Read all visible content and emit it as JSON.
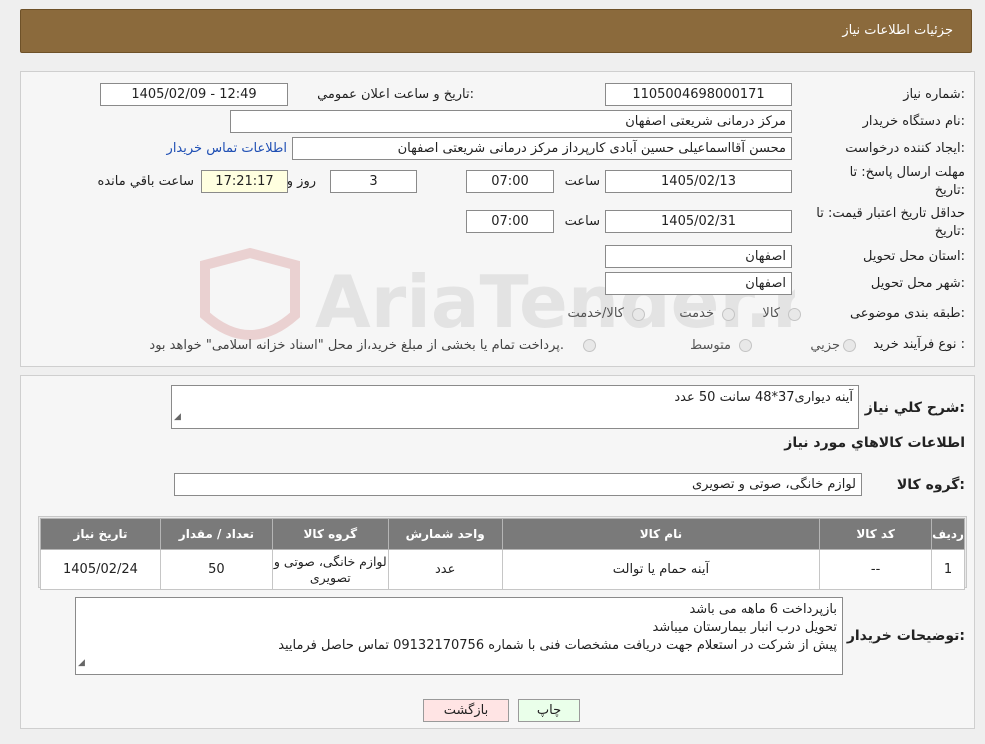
{
  "header": {
    "title": "جزئیات اطلاعات نیاز"
  },
  "watermark": {
    "text": "AriaTender.neT"
  },
  "form": {
    "need_number": {
      "label": "شماره نیاز:",
      "value": "1105004698000171"
    },
    "announce_datetime": {
      "label": "تاریخ و ساعت اعلان عمومي:",
      "value": "1405/02/09 - 12:49"
    },
    "buyer_org": {
      "label": "نام دستگاه خريدار:",
      "value": "مرکز درمانی شریعتی اصفهان"
    },
    "requester": {
      "label": "ايجاد کننده درخواست:",
      "value": "محسن آقااسماعیلی حسین آبادی کارپرداز مرکز درمانی شریعتی اصفهان",
      "contact_link": "اطلاعات تماس خريدار"
    },
    "reply_deadline": {
      "label_line1": "مهلت ارسال پاسخ: تا",
      "label_line2": "تاريخ:",
      "date": "1405/02/13",
      "time_label": "ساعت",
      "time": "07:00",
      "days": "3",
      "days_label": "روز و",
      "remaining": "17:21:17",
      "remaining_label": "ساعت باقي مانده"
    },
    "price_validity": {
      "label_line1": "حداقل تاريخ اعتبار قيمت: تا",
      "label_line2": "تاريخ:",
      "date": "1405/02/31",
      "time_label": "ساعت",
      "time": "07:00"
    },
    "province": {
      "label": "استان محل تحويل:",
      "value": "اصفهان"
    },
    "city": {
      "label": "شهر محل تحويل:",
      "value": "اصفهان"
    },
    "category": {
      "label": "طبقه بندی موضوعی:",
      "options": [
        "کالا",
        "خدمت",
        "کالا/خدمت"
      ]
    },
    "purchase_type": {
      "label": "نوع فرآیند خرید :",
      "options": [
        "جزيي",
        "متوسط"
      ],
      "note": "پرداخت تمام یا بخشی از مبلغ خرید،از محل \"اسناد خزانه اسلامی\" خواهد بود."
    }
  },
  "description": {
    "label": "شرح کلي نياز:",
    "value": "آینه دیواری37*48 سانت  50 عدد"
  },
  "goods_section": {
    "title": "اطلاعات کالاهاي مورد نياز"
  },
  "goods_group": {
    "label": "گروه کالا:",
    "value": "لوازم خانگی، صوتی و تصویری"
  },
  "table": {
    "headers": [
      "رديف",
      "کد کالا",
      "نام کالا",
      "واحد شمارش",
      "گروه کالا",
      "تعداد / مقدار",
      "تاريخ نياز"
    ],
    "rows": [
      [
        "1",
        "--",
        "آینه حمام یا توالت",
        "عدد",
        "لوازم خانگی، صوتی و تصویری",
        "50",
        "1405/02/24"
      ]
    ]
  },
  "buyer_notes": {
    "label": "توضيحات خريدار:",
    "lines": [
      "بازپرداخت 6 ماهه می باشد",
      "تحویل درب انبار بیمارستان میباشد",
      "پیش از شرکت در استعلام جهت دریافت مشخصات فنی با شماره 09132170756 تماس حاصل فرمایید"
    ]
  },
  "buttons": {
    "print": "چاپ",
    "back": "بازگشت"
  }
}
